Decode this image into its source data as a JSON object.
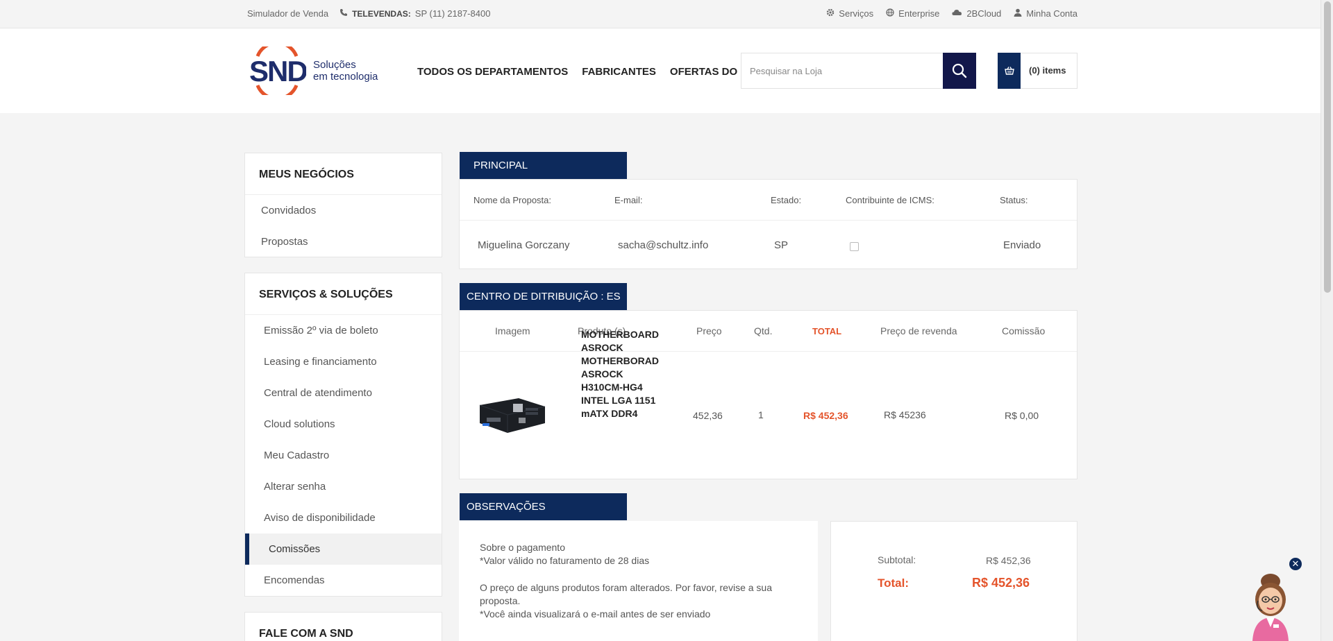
{
  "topbar": {
    "simulator": "Simulador de Venda",
    "televendas_label": "TELEVENDAS:",
    "televendas_phone": "SP (11)  2187-8400",
    "links": [
      "Serviços",
      "Enterprise",
      "2BCloud",
      "Minha Conta"
    ]
  },
  "logo": {
    "brand": "SND",
    "tagline_1": "Soluções",
    "tagline_2": "em tecnologia"
  },
  "nav": [
    "TODOS OS DEPARTAMENTOS",
    "FABRICANTES",
    "OFERTAS DO DIA"
  ],
  "search": {
    "placeholder": "Pesquisar na Loja"
  },
  "cart": {
    "label": "(0) items"
  },
  "sidebar": {
    "negocios": {
      "title": "MEUS NEGÓCIOS",
      "items": [
        "Convidados",
        "Propostas"
      ]
    },
    "servicos": {
      "title": "SERVIÇOS & SOLUÇÕES",
      "items": [
        "Emissão 2º via de boleto",
        "Leasing e financiamento",
        "Central de atendimento",
        "Cloud solutions",
        "Meu Cadastro",
        "Alterar senha",
        "Aviso de disponibilidade",
        "Comissões",
        "Encomendas"
      ],
      "active": "Comissões"
    },
    "fale": {
      "title": "FALE COM A SND"
    }
  },
  "principal": {
    "title": "PRINCIPAL",
    "headers": {
      "nome": "Nome da Proposta:",
      "email": "E-mail:",
      "estado": "Estado:",
      "icms": "Contribuinte de ICMS:",
      "status": "Status:"
    },
    "values": {
      "nome": "Miguelina Gorczany",
      "email": "sacha@schultz.info",
      "estado": "SP",
      "icms_checked": false,
      "status": "Enviado"
    }
  },
  "centro": {
    "title": "CENTRO DE DITRIBUIÇÃO : ES",
    "headers": {
      "imagem": "Imagem",
      "produto": "Produto (s)",
      "preco": "Preço",
      "qtd": "Qtd.",
      "total": "TOTAL",
      "revenda": "Preço de revenda",
      "comissao": "Comissão"
    },
    "row": {
      "produto_lines": [
        "MOTHERBOARD",
        "ASROCK",
        "MOTHERBORAD",
        "ASROCK",
        "H310CM-HG4",
        "INTEL LGA 1151",
        "mATX DDR4"
      ],
      "preco": "452,36",
      "qtd": "1",
      "total": "R$ 452,36",
      "revenda": "R$ 45236",
      "comissao": "R$ 0,00"
    }
  },
  "observacoes": {
    "title": "OBSERVAÇÕES",
    "line1": "Sobre o pagamento",
    "line2": "*Valor válido no faturamento de 28 dias",
    "line3": "O preço de alguns produtos foram alterados. Por favor, revise a sua",
    "line4": "proposta.",
    "line5": "*Você ainda visualizará o e-mail antes de ser enviado"
  },
  "summary": {
    "subtotal_label": "Subtotal:",
    "subtotal": "R$ 452,36",
    "total_label": "Total:",
    "total": "R$ 452,36"
  },
  "colors": {
    "navy": "#0d2a5c",
    "accent": "#e4542b",
    "search_btn": "#12174a"
  }
}
